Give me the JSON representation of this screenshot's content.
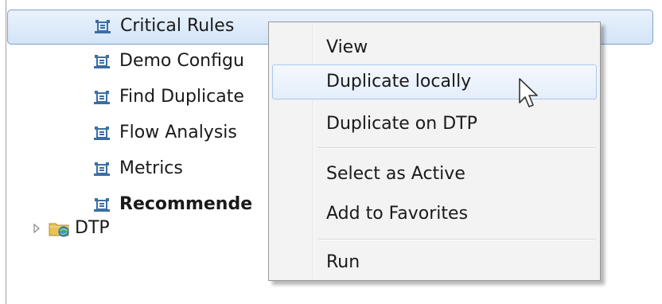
{
  "tree": {
    "items": [
      {
        "label": "Critical Rules",
        "icon": "rule-config-icon",
        "selected": true,
        "bold": false
      },
      {
        "label": "Demo Configu",
        "icon": "rule-config-icon",
        "selected": false,
        "bold": false
      },
      {
        "label": "Find Duplicate",
        "icon": "rule-config-icon",
        "selected": false,
        "bold": false
      },
      {
        "label": "Flow Analysis",
        "icon": "rule-config-icon",
        "selected": false,
        "bold": false
      },
      {
        "label": "Metrics",
        "icon": "rule-config-icon",
        "selected": false,
        "bold": false
      },
      {
        "label": "Recommende",
        "icon": "rule-config-icon",
        "selected": false,
        "bold": true
      }
    ],
    "folder": {
      "label": "DTP",
      "icon": "dtp-folder-icon",
      "expanded": false
    }
  },
  "context_menu": {
    "items": [
      {
        "label": "View",
        "hover": false
      },
      {
        "label": "Duplicate locally",
        "hover": true
      },
      {
        "label": "Duplicate on DTP",
        "hover": false
      },
      {
        "label": "Select as Active",
        "hover": false
      },
      {
        "label": "Add to Favorites",
        "hover": false
      },
      {
        "label": "Run",
        "hover": false
      }
    ]
  },
  "colors": {
    "selection_border": "#7da2ce",
    "menu_background": "#f3f3f3",
    "menu_hover_border": "#a8c9f0"
  }
}
